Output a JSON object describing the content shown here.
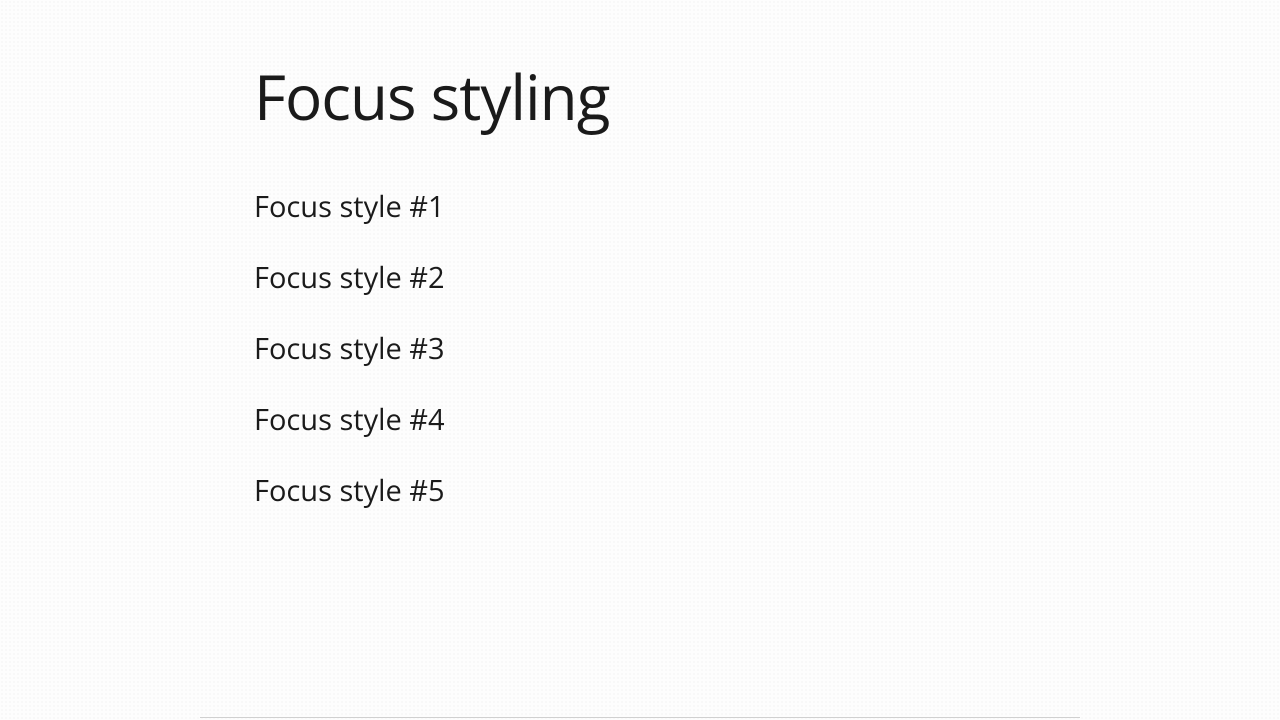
{
  "page": {
    "title": "Focus styling"
  },
  "links": [
    {
      "label": "Focus style #1"
    },
    {
      "label": "Focus style #2"
    },
    {
      "label": "Focus style #3"
    },
    {
      "label": "Focus style #4"
    },
    {
      "label": "Focus style #5"
    }
  ]
}
